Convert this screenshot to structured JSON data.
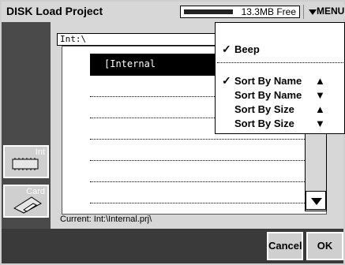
{
  "window": {
    "title": "DISK Load Project",
    "free_space": "13.3MB Free",
    "menu_label": "MENU"
  },
  "path": {
    "value": "Int:\\"
  },
  "devices": [
    {
      "label": "Int",
      "icon": "internal-memory-icon"
    },
    {
      "label": "Card",
      "icon": "card-icon"
    }
  ],
  "files": {
    "items": [
      {
        "name": "[Internal",
        "selected": true
      },
      {
        "name": "",
        "selected": false
      },
      {
        "name": "",
        "selected": false
      },
      {
        "name": "",
        "selected": false
      },
      {
        "name": "",
        "selected": false
      },
      {
        "name": "",
        "selected": false
      },
      {
        "name": "",
        "selected": false
      }
    ]
  },
  "status": {
    "current": "Current: Int:\\Internal.prj\\"
  },
  "buttons": {
    "cancel": "Cancel",
    "ok": "OK"
  },
  "menu": {
    "items": [
      {
        "label": "Beep",
        "checked": true,
        "arrow": ""
      },
      {
        "label": "Sort By Name",
        "checked": true,
        "arrow": "▲"
      },
      {
        "label": "Sort By Name",
        "checked": false,
        "arrow": "▼"
      },
      {
        "label": "Sort By Size",
        "checked": false,
        "arrow": "▲"
      },
      {
        "label": "Sort By Size",
        "checked": false,
        "arrow": "▼"
      }
    ]
  }
}
